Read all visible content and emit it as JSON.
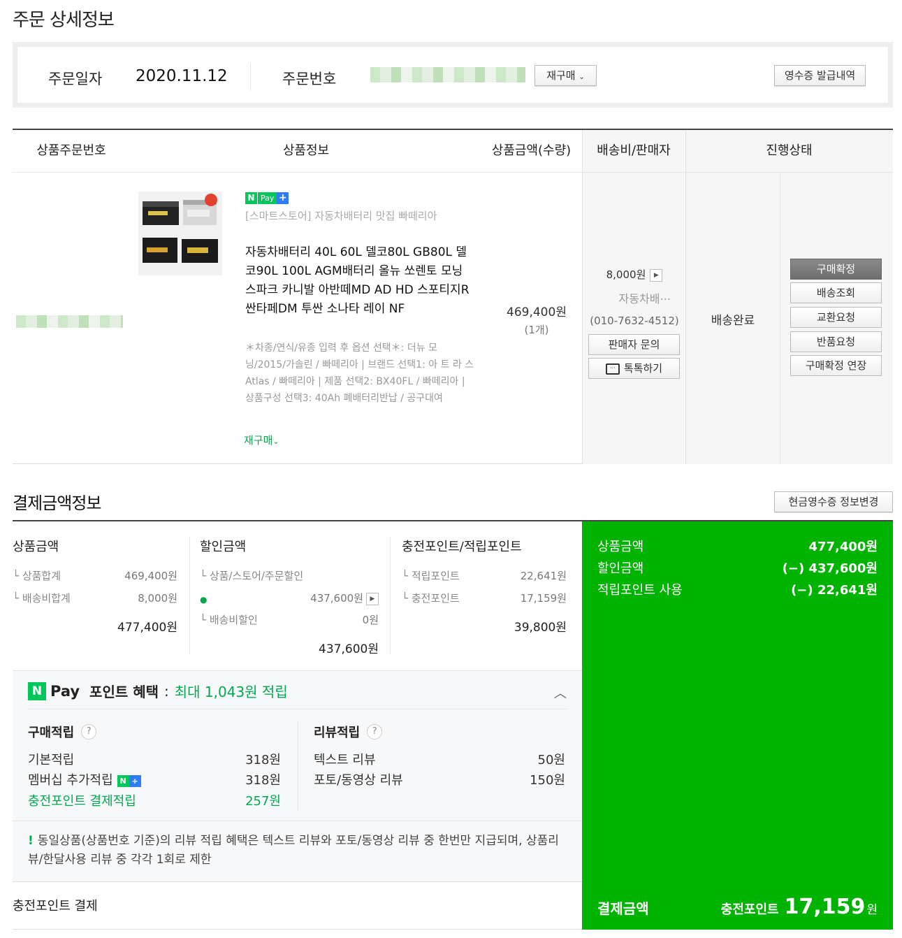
{
  "page": {
    "title": "주문 상세정보"
  },
  "summary": {
    "order_date_label": "주문일자",
    "order_date": "2020.11.12",
    "order_no_label": "주문번호",
    "rebuy_button": "재구매",
    "receipt_button": "영수증 발급내역"
  },
  "table": {
    "headers": [
      "상품주문번호",
      "상품정보",
      "상품금액(수량)",
      "배송비/판매자",
      "진행상태"
    ],
    "row": {
      "npay_label": "Pay",
      "store": "[스마트스토어] 자동차배터리 맛집 빠떼리아",
      "product": "자동차배터리 40L 60L 델코80L GB80L 델코90L 100L AGM배터리 올뉴 쏘렌토 모닝 스파크 카니발 아반떼MD AD HD 스포티지R 싼타페DM 투싼 소나타 레이 NF",
      "options": "＊차종/연식/유종 입력 후 옵션 선택＊: 더뉴 모닝/2015/가솔린 / 빠떼리아 | 브랜드 선택1: 아 트 라 스 Atlas / 빠떼리아 | 제품 선택2: BX40FL / 빠떼리아 | 상품구성 선택3: 40Ah 폐배터리반납 / 공구대여",
      "rebuy_link": "재구매",
      "price": "469,400원",
      "qty": "(1개)",
      "ship_cost": "8,000원",
      "seller": "자동차배⋯",
      "phone": "(010-7632-4512)",
      "seller_inquiry": "판매자 문의",
      "talktalk": "톡톡하기",
      "status": "배송완료",
      "actions": [
        "구매확정",
        "배송조회",
        "교환요청",
        "반품요청",
        "구매확정 연장"
      ]
    }
  },
  "payment": {
    "title": "결제금액정보",
    "cash_receipt_button": "현금영수증 정보변경",
    "product_col": {
      "title": "상품금액",
      "rows": [
        {
          "label": "상품합계",
          "value": "469,400원"
        },
        {
          "label": "배송비합계",
          "value": "8,000원"
        }
      ],
      "total": "477,400원"
    },
    "discount_col": {
      "title": "할인금액",
      "row1_label": "상품/스토어/주문할인",
      "row1_value": "437,600원",
      "row2_label": "배송비할인",
      "row2_value": "0원",
      "total": "437,600원"
    },
    "point_col": {
      "title": "충전포인트/적립포인트",
      "rows": [
        {
          "label": "적립포인트",
          "value": "22,641원"
        },
        {
          "label": "충전포인트",
          "value": "17,159원"
        }
      ],
      "total": "39,800원"
    },
    "green_panel": {
      "rows": [
        {
          "label": "상품금액",
          "value": "477,400원"
        },
        {
          "label": "할인금액",
          "value": "(−) 437,600원"
        },
        {
          "label": "적립포인트 사용",
          "value": "(−) 22,641원"
        }
      ],
      "final_label": "결제금액",
      "final_method": "충전포인트",
      "final_amount": "17,159",
      "final_unit": "원",
      "color": "#00b300"
    },
    "charge_point_label": "충전포인트 결제"
  },
  "npay_points": {
    "pay_word": "Pay",
    "title": "포인트 혜택",
    "colon": ":",
    "max_text": "최대 1,043원 적립",
    "purchase": {
      "title": "구매적립",
      "rows": [
        {
          "label": "기본적립",
          "value": "318원"
        },
        {
          "label": "멤버십 추가적립",
          "value": "318원"
        },
        {
          "label": "충전포인트 결제적립",
          "value": "257원"
        }
      ]
    },
    "review": {
      "title": "리뷰적립",
      "rows": [
        {
          "label": "텍스트 리뷰",
          "value": "50원"
        },
        {
          "label": "포토/동영상 리뷰",
          "value": "150원"
        }
      ]
    },
    "notice": "동일상품(상품번호 기준)의 리뷰 적립 혜택은 텍스트 리뷰와 포토/동영상 리뷰 중 한번만 지급되며, 상품리뷰/한달사용 리뷰 중 각각 1회로 제한"
  }
}
